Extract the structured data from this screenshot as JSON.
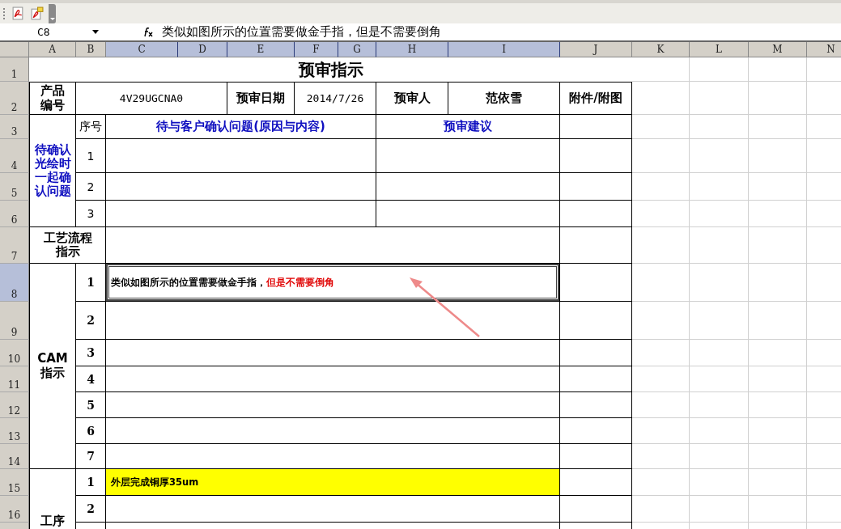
{
  "formula_bar": {
    "cell_ref": "C8",
    "formula": "类似如图所示的位置需要做金手指，但是不需要倒角"
  },
  "columns": [
    {
      "label": "A",
      "selected": false
    },
    {
      "label": "B",
      "selected": false
    },
    {
      "label": "C",
      "selected": true
    },
    {
      "label": "D",
      "selected": true
    },
    {
      "label": "E",
      "selected": true
    },
    {
      "label": "F",
      "selected": true
    },
    {
      "label": "G",
      "selected": true
    },
    {
      "label": "H",
      "selected": true
    },
    {
      "label": "I",
      "selected": true
    },
    {
      "label": "J",
      "selected": false
    },
    {
      "label": "K",
      "selected": false
    },
    {
      "label": "L",
      "selected": false
    },
    {
      "label": "M",
      "selected": false
    },
    {
      "label": "N",
      "selected": false
    }
  ],
  "rows": [
    {
      "label": "1",
      "selected": false
    },
    {
      "label": "2",
      "selected": false
    },
    {
      "label": "3",
      "selected": false
    },
    {
      "label": "4",
      "selected": false
    },
    {
      "label": "5",
      "selected": false
    },
    {
      "label": "6",
      "selected": false
    },
    {
      "label": "7",
      "selected": false
    },
    {
      "label": "8",
      "selected": true
    },
    {
      "label": "9",
      "selected": false
    },
    {
      "label": "10",
      "selected": false
    },
    {
      "label": "11",
      "selected": false
    },
    {
      "label": "12",
      "selected": false
    },
    {
      "label": "13",
      "selected": false
    },
    {
      "label": "14",
      "selected": false
    },
    {
      "label": "15",
      "selected": false
    },
    {
      "label": "16",
      "selected": false
    }
  ],
  "sheet": {
    "title": "预审指示",
    "product_code_label": "产品编号",
    "product_code": "4V29UGCNA0",
    "review_date_label": "预审日期",
    "review_date": "2014/7/26",
    "reviewer_label": "预审人",
    "reviewer": "范依雪",
    "attachments_label": "附件/附图",
    "questions": {
      "label": "待确认光绘时一起确认问题",
      "number_heading": "序号",
      "issue_heading": "待与客户确认问题(原因与内容)",
      "advice_heading": "预审建议",
      "items": [
        {
          "number": "1"
        },
        {
          "number": "2"
        },
        {
          "number": "3"
        }
      ]
    },
    "process_flow": {
      "label": "工艺流程指示"
    },
    "cam": {
      "label": "CAM指示",
      "items": [
        {
          "number": "1",
          "selected": true,
          "segments": [
            {
              "text": "类似如图所示的位置需要做金手指，",
              "warning": false
            },
            {
              "text": "但是不需要倒角",
              "warning": true
            }
          ]
        },
        {
          "number": "2",
          "selected": false
        },
        {
          "number": "3",
          "selected": false
        },
        {
          "number": "4",
          "selected": false
        },
        {
          "number": "5",
          "selected": false
        },
        {
          "number": "6",
          "selected": false
        },
        {
          "number": "7",
          "selected": false
        }
      ]
    },
    "operations": {
      "label": "工序",
      "items": [
        {
          "number": "1",
          "selected": false,
          "highlighted": true,
          "text": "外层完成铜厚35um"
        },
        {
          "number": "2",
          "selected": false,
          "highlighted": false
        }
      ]
    }
  }
}
